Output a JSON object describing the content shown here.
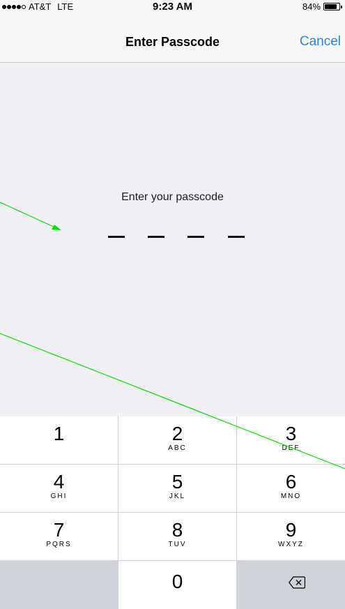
{
  "status_bar": {
    "carrier": "AT&T",
    "network": "LTE",
    "time": "9:23 AM",
    "battery_percent": "84%",
    "battery_level": 0.84,
    "signal_bars": 4,
    "signal_max": 5
  },
  "nav": {
    "title": "Enter Passcode",
    "cancel_label": "Cancel"
  },
  "content": {
    "prompt": "Enter your passcode",
    "passcode_length": 4,
    "entered_digits": 0
  },
  "keypad": {
    "keys": [
      {
        "digit": "1",
        "letters": ""
      },
      {
        "digit": "2",
        "letters": "ABC"
      },
      {
        "digit": "3",
        "letters": "DEF"
      },
      {
        "digit": "4",
        "letters": "GHI"
      },
      {
        "digit": "5",
        "letters": "JKL"
      },
      {
        "digit": "6",
        "letters": "MNO"
      },
      {
        "digit": "7",
        "letters": "PQRS"
      },
      {
        "digit": "8",
        "letters": "TUV"
      },
      {
        "digit": "9",
        "letters": "WXYZ"
      },
      {
        "digit": "0",
        "letters": ""
      }
    ],
    "delete_icon": "backspace-icon"
  },
  "colors": {
    "accent": "#2b82e4",
    "annotation": "#00e000",
    "background": "#efeff4",
    "keypad_gray": "#cfd3d9"
  }
}
